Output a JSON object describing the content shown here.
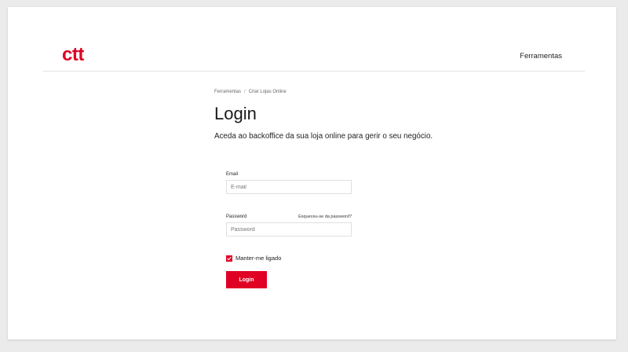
{
  "header": {
    "logo_text": "ctt",
    "nav_link": "Ferramentas"
  },
  "breadcrumb": {
    "items": [
      "Ferramentas",
      "Criar Lojas Online"
    ],
    "separator": "/"
  },
  "main": {
    "title": "Login",
    "subtitle": "Aceda ao backoffice da sua loja online para gerir o seu negócio."
  },
  "form": {
    "email_label": "Email",
    "email_placeholder": "E-mail",
    "password_label": "Password",
    "forgot_link": "Esqueceu-se da password?",
    "password_placeholder": "Password",
    "remember_label": "Manter-me ligado",
    "remember_checked": true,
    "login_button": "Login"
  },
  "colors": {
    "brand_red": "#df0024"
  }
}
